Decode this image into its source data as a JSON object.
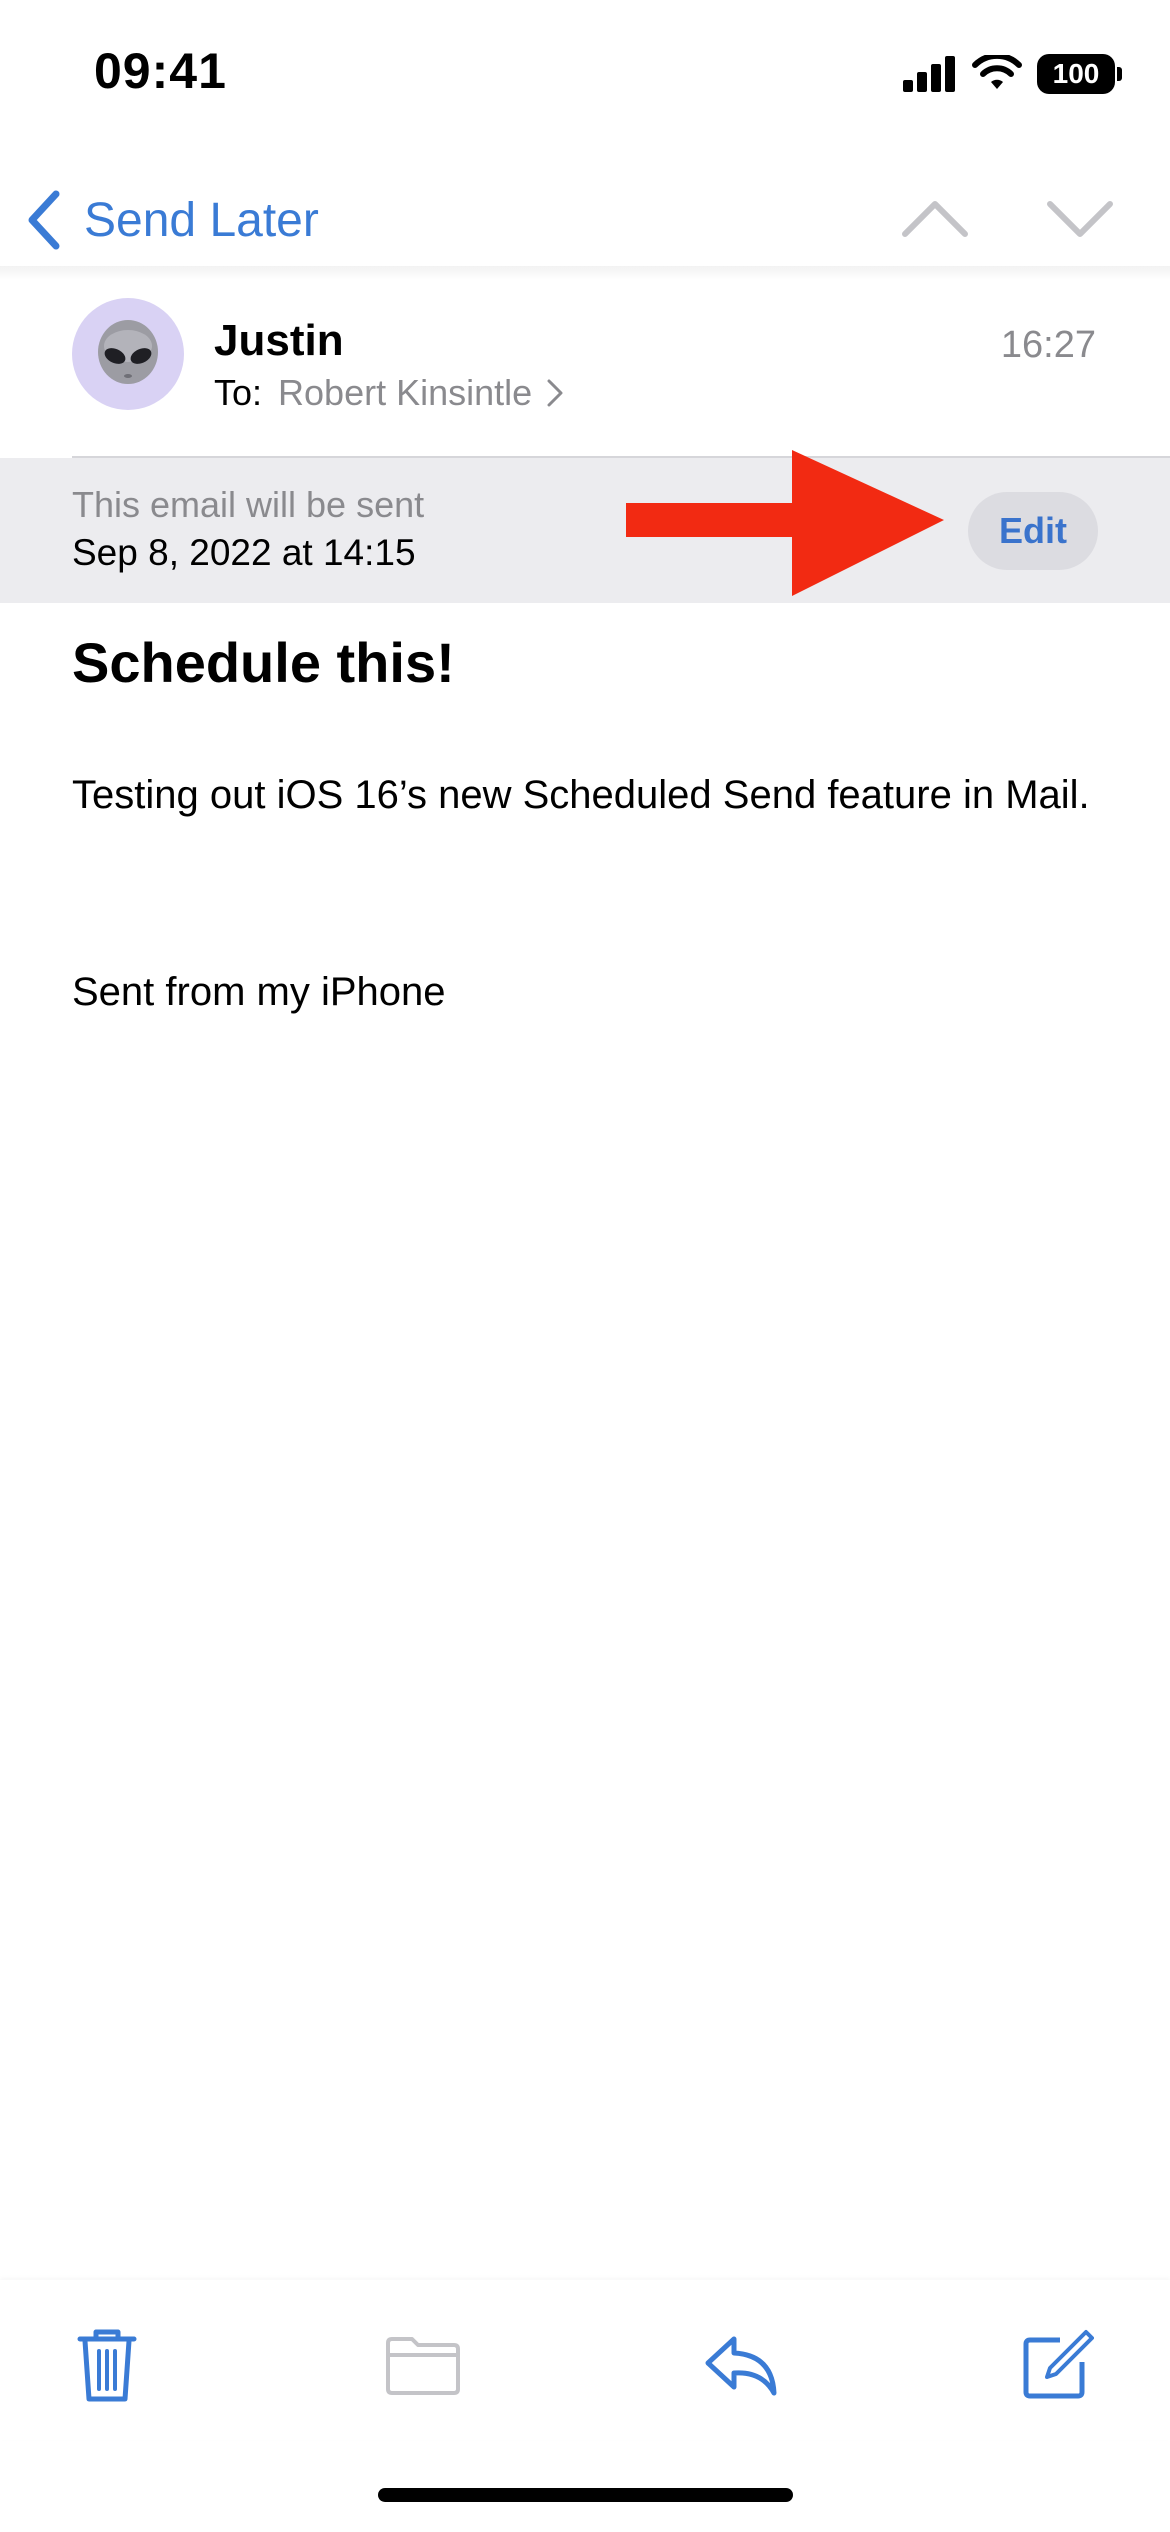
{
  "status_bar": {
    "time": "09:41",
    "battery": "100",
    "icons": [
      "cellular-signal-icon",
      "wifi-icon",
      "battery-icon"
    ]
  },
  "nav": {
    "back_label": "Send Later",
    "icons": [
      "chevron-left-icon",
      "chevron-up-icon",
      "chevron-down-icon"
    ]
  },
  "email": {
    "sender": "Justin",
    "to_prefix": "To:",
    "recipient": "Robert Kinsintle",
    "time": "16:27",
    "avatar_icon": "alien-avatar-icon",
    "schedule": {
      "label": "This email will be sent",
      "date": "Sep 8, 2022 at 14:15",
      "edit_label": "Edit"
    },
    "subject": "Schedule this!",
    "body": "Testing out iOS 16’s new Scheduled Send feature in Mail.",
    "signature": "Sent from my iPhone"
  },
  "toolbar": {
    "items": [
      "trash-icon",
      "folder-icon",
      "reply-icon",
      "compose-icon"
    ]
  },
  "colors": {
    "accent": "#3a7bd5",
    "banner_bg": "#ececef",
    "secondary_text": "#8a8a8e",
    "annotation_arrow": "#f22a12",
    "avatar_bg": "#d9d2f4"
  }
}
